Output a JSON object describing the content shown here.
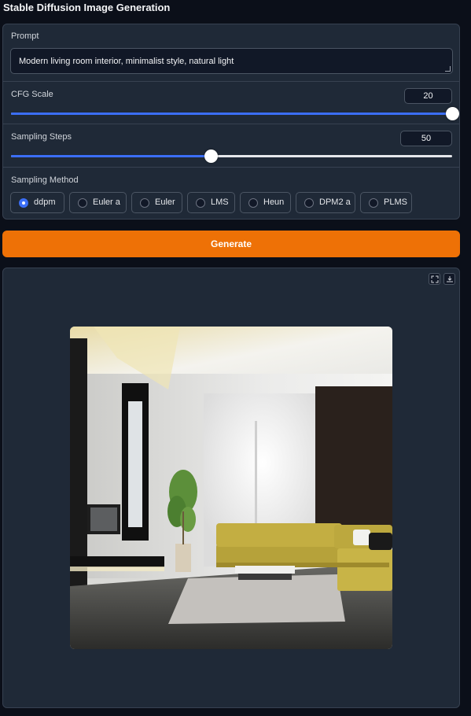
{
  "app": {
    "title": "Stable Diffusion Image Generation"
  },
  "prompt": {
    "label": "Prompt",
    "value": "Modern living room interior, minimalist style, natural light"
  },
  "cfg_scale": {
    "label": "CFG Scale",
    "value": "20",
    "fraction": 1.0
  },
  "sampling_steps": {
    "label": "Sampling Steps",
    "value": "50",
    "fraction": 0.452
  },
  "sampling_method": {
    "label": "Sampling Method",
    "options": [
      "ddpm",
      "Euler a",
      "Euler",
      "LMS",
      "Heun",
      "DPM2 a",
      "PLMS"
    ],
    "selected": "ddpm"
  },
  "generate": {
    "label": "Generate"
  },
  "output": {
    "image_alt": "Generated image: modern living room interior",
    "fullscreen_icon": "fullscreen-icon",
    "download_icon": "download-icon"
  },
  "colors": {
    "accent": "#3b6ef6",
    "generate": "#ee7106",
    "panel": "#1f2937",
    "background": "#0b0f19"
  }
}
